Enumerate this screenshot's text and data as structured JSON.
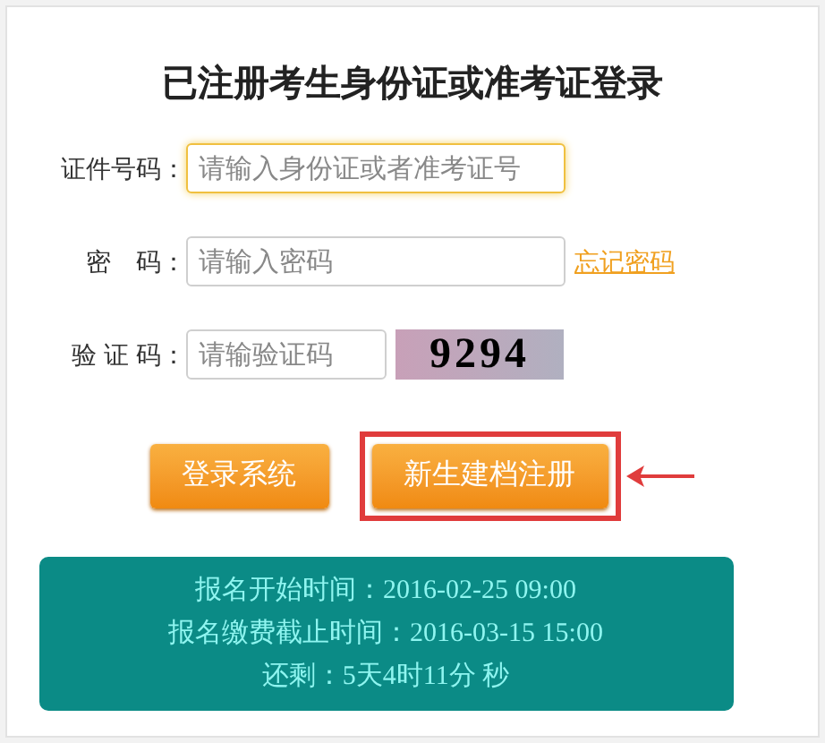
{
  "title": "已注册考生身份证或准考证登录",
  "fields": [
    {
      "kind": "text",
      "label": "证件号码：",
      "placeholder": "请输入身份证或者准考证号",
      "focused": true
    },
    {
      "kind": "password",
      "label": "密　码：",
      "placeholder": "请输入密码",
      "focused": false,
      "link": "忘记密码"
    },
    {
      "kind": "captcha",
      "label": "验 证 码：",
      "placeholder": "请输验证码",
      "focused": false,
      "captcha": "9294"
    }
  ],
  "buttons": [
    {
      "label": "登录系统",
      "highlighted": false
    },
    {
      "label": "新生建档注册",
      "highlighted": true
    }
  ],
  "info": [
    "报名开始时间：2016-02-25 09:00",
    "报名缴费截止时间：2016-03-15 15:00",
    "还剩：5天4时11分 秒"
  ]
}
